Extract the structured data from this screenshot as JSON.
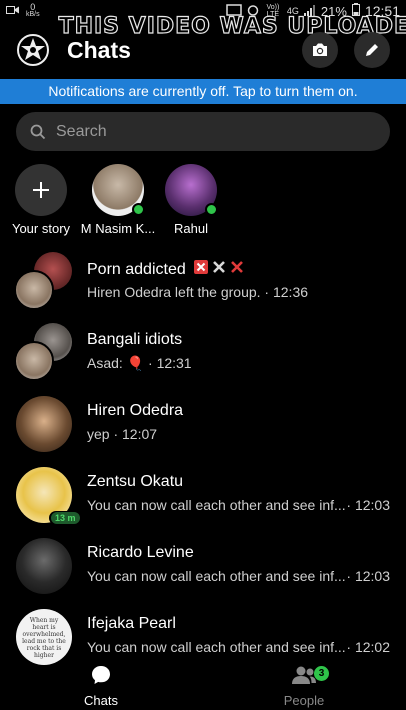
{
  "status_bar": {
    "data_small_top": "0",
    "data_small_unit": "kB/s",
    "volte": "Vo)) LTE",
    "network": "4G",
    "battery": "21%",
    "time": "12:51"
  },
  "watermark": "THIS VIDEO WAS UPLOADE",
  "header": {
    "title": "Chats"
  },
  "notification_banner": "Notifications are currently off. Tap to turn them on.",
  "search": {
    "placeholder": "Search"
  },
  "stories": [
    {
      "label": "Your story"
    },
    {
      "label": "M Nasim K..."
    },
    {
      "label": "Rahul"
    }
  ],
  "chats": [
    {
      "name": "Porn addicted",
      "preview": "Hiren Odedra left the group. · 12:36",
      "time": ""
    },
    {
      "name": "Bangali idiots",
      "preview": "Asad: 🎈 · 12:31",
      "time": ""
    },
    {
      "name": "Hiren Odedra",
      "preview": "yep · 12:07",
      "time": ""
    },
    {
      "name": "Zentsu Okatu",
      "preview": "You can now call each other and see inf...",
      "time": "· 12:03",
      "badge": "13 m"
    },
    {
      "name": "Ricardo Levine",
      "preview": "You can now call each other and see inf...",
      "time": "· 12:03"
    },
    {
      "name": "Ifejaka Pearl",
      "preview": "You can now call each other and see inf...",
      "time": "· 12:02",
      "avatar_text": "When my heart is overwhelmed, lead me to the rock that is higher"
    }
  ],
  "bottom_nav": {
    "chats_label": "Chats",
    "people_label": "People",
    "people_badge": "3"
  },
  "colors": {
    "accent_blue": "#1f7ed6",
    "online_green": "#2fc44a",
    "background": "#000000"
  }
}
